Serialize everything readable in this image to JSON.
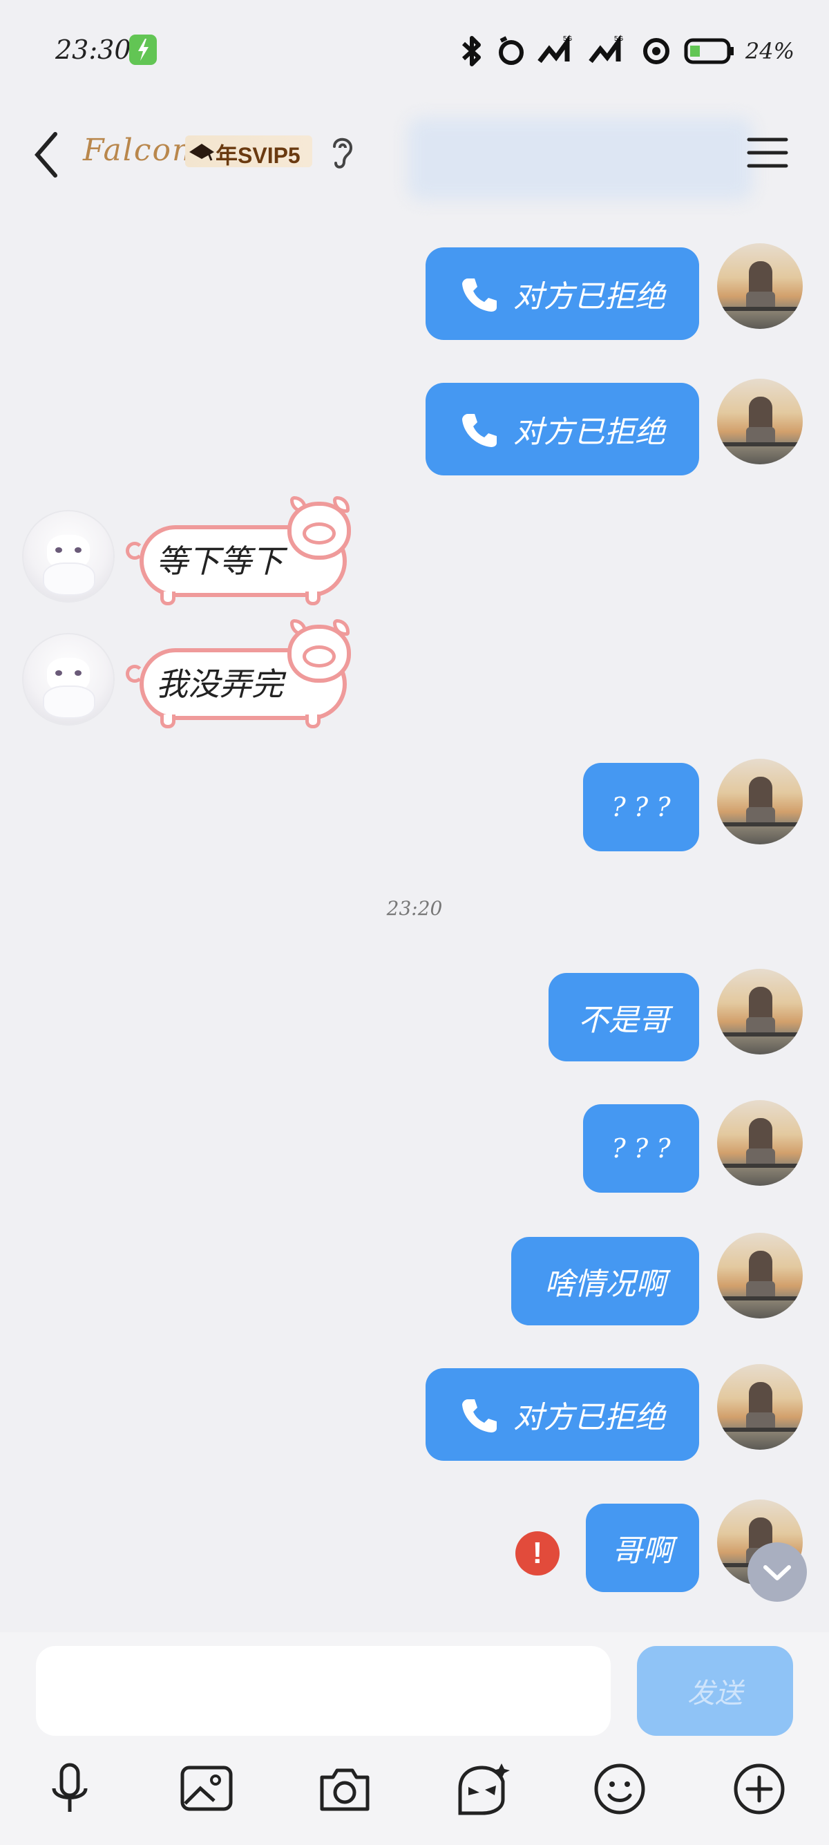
{
  "status_bar": {
    "time": "23:30",
    "battery": "24%"
  },
  "header": {
    "title": "Falcon",
    "vip_badge": "年SVIP5"
  },
  "messages": {
    "m1": "对方已拒绝",
    "m2": "对方已拒绝",
    "m3": "等下等下",
    "m4": "我没弄完",
    "m5": "? ? ?",
    "timestamp": "23:20",
    "m6": "不是哥",
    "m7": "? ? ?",
    "m8": "啥情况啊",
    "m9": "对方已拒绝",
    "m10": "哥啊"
  },
  "error_mark": "!",
  "input": {
    "value": "",
    "send_label": "发送"
  },
  "icons": [
    "back-arrow-icon",
    "ear-icon",
    "menu-icon",
    "phone-icon",
    "error-icon",
    "chevron-down-icon",
    "microphone-icon",
    "image-icon",
    "camera-icon",
    "sticker-icon",
    "emoji-icon",
    "plus-icon"
  ],
  "colors": {
    "bubble_blue": "#4598f2",
    "send_disabled": "#8fc3f6",
    "error_red": "#e24b3b",
    "pig_pink": "#ef9a9a",
    "vip_gold": "#b9874c"
  }
}
